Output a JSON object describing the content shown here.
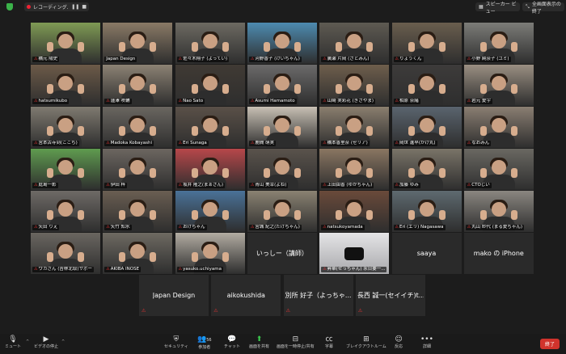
{
  "topbar": {
    "recording_label": "レコーディング...",
    "pause_icon": "pause-icon",
    "stop_icon": "stop-icon",
    "view_label": "スピーカー ビュー",
    "fullscreen_label": "全画面表示の終了"
  },
  "participants": [
    {
      "name": "橋元 陽史",
      "muted": true,
      "bg": "#7f9a54"
    },
    {
      "name": "Japan Design",
      "muted": false,
      "bg": "#8a7a66",
      "active": true
    },
    {
      "name": "佐々木翔子 (よってい)",
      "muted": true,
      "bg": "#6d6a62"
    },
    {
      "name": "河野香子 (けいちゃん)",
      "muted": true,
      "bg": "#4d8bb0"
    },
    {
      "name": "廣瀬 片岡 (さとみん)",
      "muted": true,
      "bg": "#5e5a52"
    },
    {
      "name": "りょうくん",
      "muted": true,
      "bg": "#6a5e4e"
    },
    {
      "name": "小野 純奈子 (ユミ)",
      "muted": true,
      "bg": "#7c7c78"
    },
    {
      "name": "hatsumikubo",
      "muted": true,
      "bg": "#6c5a48"
    },
    {
      "name": "蓮澤 咲輔",
      "muted": true,
      "bg": "#8c8274"
    },
    {
      "name": "Nao Sato",
      "muted": true,
      "bg": "#403a34"
    },
    {
      "name": "Asumi Hamamoto",
      "muted": true,
      "bg": "#6b6a6a"
    },
    {
      "name": "山崎 実彩花 (ぎさやま)",
      "muted": true,
      "bg": "#6e5e4c"
    },
    {
      "name": "相原 奈緒",
      "muted": true,
      "bg": "#3d3b3a"
    },
    {
      "name": "岩元 愛宇",
      "muted": true,
      "bg": "#9a8f82"
    },
    {
      "name": "宮本古寺到(ここち)",
      "muted": true,
      "bg": "#7f7a70"
    },
    {
      "name": "Madoka Kobayashi",
      "muted": true,
      "bg": "#6a6660"
    },
    {
      "name": "Eri Sunaga",
      "muted": true,
      "bg": "#5a5048"
    },
    {
      "name": "鹿間 萌実",
      "muted": true,
      "bg": "#c8c0b4"
    },
    {
      "name": "橋本香里奈 (ゼリア)",
      "muted": true,
      "bg": "#8a7e6e"
    },
    {
      "name": "岡世 進早(かげ丸)",
      "muted": true,
      "bg": "#5a646e"
    },
    {
      "name": "なおみん",
      "muted": true,
      "bg": "#8a7e72"
    },
    {
      "name": "庭島一彰",
      "muted": true,
      "bg": "#5f9b4f"
    },
    {
      "name": "伊田 梓",
      "muted": true,
      "bg": "#6c6660"
    },
    {
      "name": "坂井 隆之(まぁさん)",
      "muted": true,
      "bg": "#b7474a"
    },
    {
      "name": "青山 美幸(よね)",
      "muted": true,
      "bg": "#5a534c"
    },
    {
      "name": "上田由香 (ゆかちゃん)",
      "muted": true,
      "bg": "#8a7662"
    },
    {
      "name": "加藤 ゆみ",
      "muted": true,
      "bg": "#7a7468"
    },
    {
      "name": "CTOじい",
      "muted": true,
      "bg": "#6a6862"
    },
    {
      "name": "矢田 りえ",
      "muted": true,
      "bg": "#6e6a66"
    },
    {
      "name": "矢竹 知水",
      "muted": true,
      "bg": "#6a5e52"
    },
    {
      "name": "おけちゃん",
      "muted": true,
      "bg": "#4a7298"
    },
    {
      "name": "宮城 紀之(たけちゃん)",
      "muted": true,
      "bg": "#8a8272"
    },
    {
      "name": "natsukoyamada",
      "muted": true,
      "bg": "#6a4a3a"
    },
    {
      "name": "Eri (エリ) Nagasawa",
      "muted": true,
      "bg": "#5e6a70"
    },
    {
      "name": "丸山 紗代 (まる愛ちゃん)",
      "muted": true,
      "bg": "#8a8680"
    },
    {
      "name": "ウカさん (吉林北取)サポー",
      "muted": true,
      "bg": "#6a6660"
    },
    {
      "name": "AKIBA INOSE",
      "muted": true,
      "bg": "#6e6a62"
    },
    {
      "name": "yasuko.uchiyama",
      "muted": true,
      "bg": "#b2aca2"
    }
  ],
  "text_tiles_row6": [
    {
      "name": "いっしー（講師）"
    },
    {
      "name": "昇華(せっちゃん) 永日要一...",
      "photo": true
    },
    {
      "name": "saaya"
    },
    {
      "name": "mako の iPhone"
    }
  ],
  "text_tiles_row7": [
    {
      "name": "Japan Design"
    },
    {
      "name": "aikokushida"
    },
    {
      "name": "別所 好子（よっちゃ..."
    },
    {
      "name": "長西 誠一(セイイチ)t..."
    }
  ],
  "toolbar": {
    "mute": "ミュート",
    "video": "ビデオの停止",
    "security": "セキュリティ",
    "participants": "参加者",
    "participants_count": "56",
    "chat": "チャット",
    "share": "画面を共有",
    "pause_share": "画面を一時停止/共有",
    "record": "字幕",
    "breakout": "ブレイクアウトルーム",
    "reactions": "反応",
    "more": "詳細",
    "end": "終了"
  }
}
